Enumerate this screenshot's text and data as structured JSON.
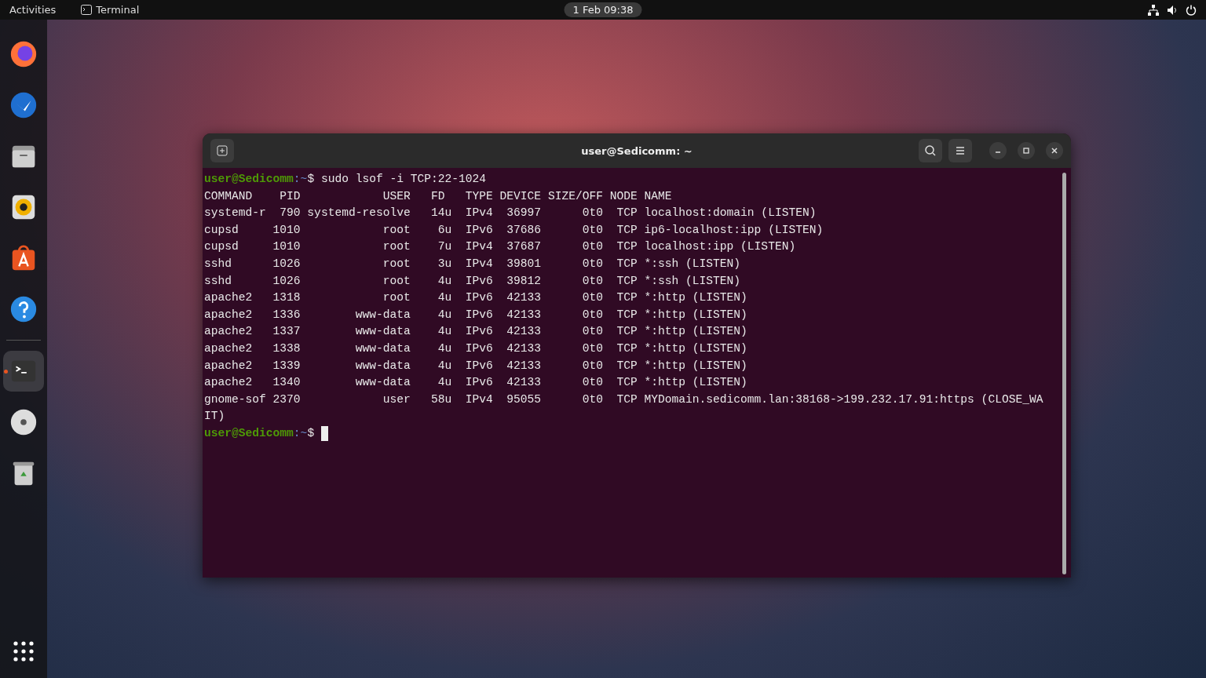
{
  "top_bar": {
    "activities": "Activities",
    "app_name": "Terminal",
    "clock": "1 Feb 09:38"
  },
  "dock": {
    "items": [
      {
        "kind": "firefox",
        "running": false
      },
      {
        "kind": "mail",
        "running": false
      },
      {
        "kind": "files",
        "running": false
      },
      {
        "kind": "music",
        "running": false
      },
      {
        "kind": "software",
        "running": false
      },
      {
        "kind": "help",
        "running": false
      },
      {
        "kind": "terminal",
        "running": true
      },
      {
        "kind": "disc",
        "running": false
      },
      {
        "kind": "trash",
        "running": false
      }
    ]
  },
  "window": {
    "title": "user@Sedicomm: ~",
    "lines": [
      {
        "kind": "prompt",
        "user_host": "user@Sedicomm",
        "path": ":~",
        "symbol": "$",
        "command": " sudo lsof -i TCP:22-1024"
      },
      {
        "kind": "output",
        "text": "COMMAND    PID            USER   FD   TYPE DEVICE SIZE/OFF NODE NAME"
      },
      {
        "kind": "output",
        "text": "systemd-r  790 systemd-resolve   14u  IPv4  36997      0t0  TCP localhost:domain (LISTEN)"
      },
      {
        "kind": "output",
        "text": "cupsd     1010            root    6u  IPv6  37686      0t0  TCP ip6-localhost:ipp (LISTEN)"
      },
      {
        "kind": "output",
        "text": "cupsd     1010            root    7u  IPv4  37687      0t0  TCP localhost:ipp (LISTEN)"
      },
      {
        "kind": "output",
        "text": "sshd      1026            root    3u  IPv4  39801      0t0  TCP *:ssh (LISTEN)"
      },
      {
        "kind": "output",
        "text": "sshd      1026            root    4u  IPv6  39812      0t0  TCP *:ssh (LISTEN)"
      },
      {
        "kind": "output",
        "text": "apache2   1318            root    4u  IPv6  42133      0t0  TCP *:http (LISTEN)"
      },
      {
        "kind": "output",
        "text": "apache2   1336        www-data    4u  IPv6  42133      0t0  TCP *:http (LISTEN)"
      },
      {
        "kind": "output",
        "text": "apache2   1337        www-data    4u  IPv6  42133      0t0  TCP *:http (LISTEN)"
      },
      {
        "kind": "output",
        "text": "apache2   1338        www-data    4u  IPv6  42133      0t0  TCP *:http (LISTEN)"
      },
      {
        "kind": "output",
        "text": "apache2   1339        www-data    4u  IPv6  42133      0t0  TCP *:http (LISTEN)"
      },
      {
        "kind": "output",
        "text": "apache2   1340        www-data    4u  IPv6  42133      0t0  TCP *:http (LISTEN)"
      },
      {
        "kind": "output",
        "text": "gnome-sof 2370            user   58u  IPv4  95055      0t0  TCP MYDomain.sedicomm.lan:38168->199.232.17.91:https (CLOSE_WA"
      },
      {
        "kind": "output",
        "text": "IT)"
      },
      {
        "kind": "prompt",
        "user_host": "user@Sedicomm",
        "path": ":~",
        "symbol": "$",
        "cursor": true
      }
    ]
  }
}
